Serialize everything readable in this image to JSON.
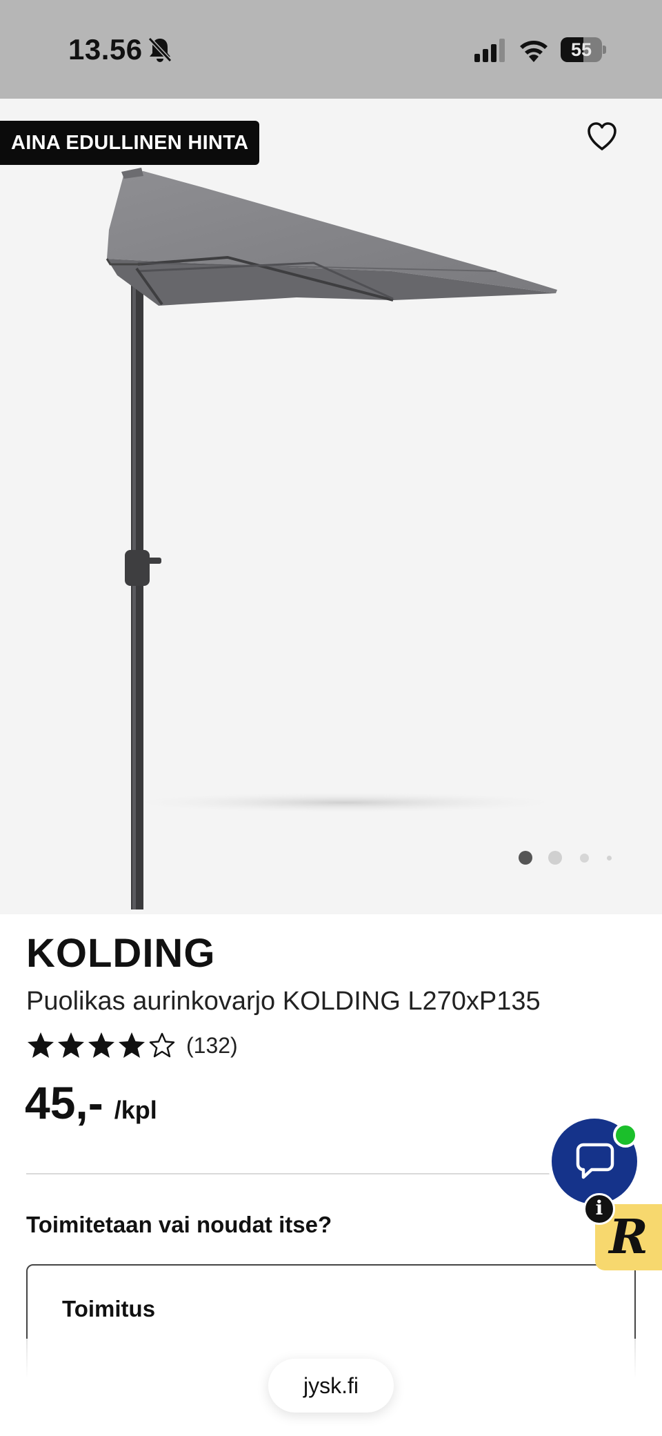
{
  "status_bar": {
    "time": "13.56",
    "battery": "55",
    "icons": [
      "bell-slash-icon",
      "cellular-signal-icon",
      "wifi-icon",
      "battery-icon"
    ]
  },
  "hero": {
    "badge": "AINA EDULLINEN HINTA",
    "favorite_icon": "heart-outline-icon",
    "image_alt_icon": "half-parasol-product-image",
    "carousel": {
      "count": 4,
      "active_index": 0
    }
  },
  "product": {
    "brand": "KOLDING",
    "name": "Puolikas aurinkovarjo KOLDING L270xP135",
    "rating": {
      "value": 4,
      "max": 5,
      "count_label": "(132)"
    },
    "price": "45,-",
    "unit": "/kpl"
  },
  "delivery": {
    "question": "Toimitetaan vai noudat itse?",
    "option_label": "Toimitus"
  },
  "widgets": {
    "chat_icon": "chat-bubble-icon",
    "info_label": "i",
    "r_label": "R"
  },
  "browser": {
    "url": "jysk.fi"
  },
  "colors": {
    "status_bar_bg": "#b6b6b6",
    "hero_bg": "#f4f4f4",
    "badge_bg": "#0b0b0b",
    "chat_bg": "#15338a",
    "online_dot": "#1bbf2b",
    "r_badge_bg": "#f7d86e"
  }
}
